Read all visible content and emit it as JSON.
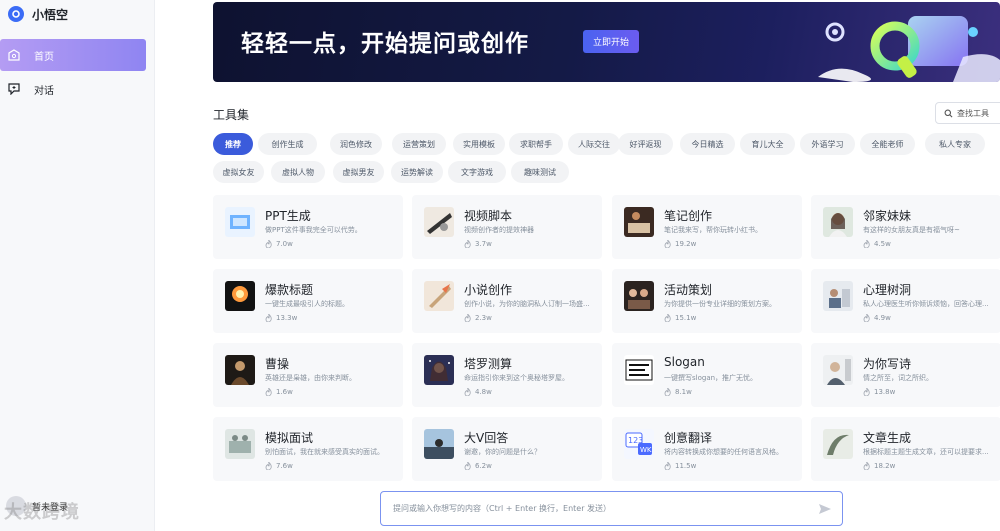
{
  "app": {
    "name": "小悟空"
  },
  "nav": [
    {
      "label": "首页",
      "icon": "home-icon",
      "active": true
    },
    {
      "label": "对话",
      "icon": "chat-icon",
      "active": false
    }
  ],
  "login": {
    "label": "暂未登录"
  },
  "watermark": "大数跨境",
  "banner": {
    "title": "轻轻一点，开始提问或创作",
    "button": "立即开始"
  },
  "tools": {
    "title": "工具集",
    "search_placeholder": "查找工具",
    "tags_row1": [
      "推荐",
      "创作生成",
      "润色修改",
      "运营策划",
      "实用模板",
      "求职帮手",
      "人际交往",
      "好评返现",
      "今日精选",
      "育儿大全",
      "外语学习",
      "全能老师",
      "私人专家"
    ],
    "tags_row2": [
      "虚拟女友",
      "虚拟人物",
      "虚拟男友",
      "运势解读",
      "文字游戏",
      "趣味测试"
    ],
    "active_tag": "推荐",
    "cards": [
      {
        "title": "PPT生成",
        "desc": "做PPT这件事我完全可以代劳。",
        "count": "7.0w",
        "thumb": "ppt"
      },
      {
        "title": "视频脚本",
        "desc": "视频创作者的提效神器",
        "count": "3.7w",
        "thumb": "video"
      },
      {
        "title": "笔记创作",
        "desc": "笔记我来写，帮你玩转小红书。",
        "count": "19.2w",
        "thumb": "notes"
      },
      {
        "title": "邻家妹妹",
        "desc": "有这样的女朋友真是有福气呀~",
        "count": "4.5w",
        "thumb": "girl"
      },
      {
        "title": "爆款标题",
        "desc": "一键生成最吸引人的标题。",
        "count": "13.3w",
        "thumb": "fire"
      },
      {
        "title": "小说创作",
        "desc": "创作小说，为你的脑洞私人订制一场盛...",
        "count": "2.3w",
        "thumb": "novel"
      },
      {
        "title": "活动策划",
        "desc": "为你提供一份专业详细的策划方案。",
        "count": "15.1w",
        "thumb": "event"
      },
      {
        "title": "心理树洞",
        "desc": "私人心理医生听你倾诉烦恼，回答心理...",
        "count": "4.9w",
        "thumb": "mind"
      },
      {
        "title": "曹操",
        "desc": "英雄还是枭雄，由你来判断。",
        "count": "1.6w",
        "thumb": "caocao"
      },
      {
        "title": "塔罗测算",
        "desc": "命运指引你来到这个奥秘塔罗屋。",
        "count": "4.8w",
        "thumb": "tarot"
      },
      {
        "title": "Slogan",
        "desc": "一键撰写slogan，推广无忧。",
        "count": "8.1w",
        "thumb": "slogan"
      },
      {
        "title": "为你写诗",
        "desc": "情之所至，词之所织。",
        "count": "13.8w",
        "thumb": "poem"
      },
      {
        "title": "模拟面试",
        "desc": "别怕面试，我在就来感受真实的面试。",
        "count": "7.6w",
        "thumb": "interview"
      },
      {
        "title": "大V回答",
        "desc": "谢邀，你的问题是什么？",
        "count": "6.2w",
        "thumb": "bigv"
      },
      {
        "title": "创意翻译",
        "desc": "将内容转换成你想要的任何语言风格。",
        "count": "11.5w",
        "thumb": "translate"
      },
      {
        "title": "文章生成",
        "desc": "根据标题主题生成文章，还可以提要求...",
        "count": "18.2w",
        "thumb": "article"
      }
    ]
  },
  "chat": {
    "placeholder": "提问或输入你想写的内容（Ctrl + Enter 换行，Enter 发送）"
  },
  "colors": {
    "accent": "#3b5bdb",
    "nav_active_start": "#b49cf3",
    "nav_active_end": "#8f85f2",
    "banner_bg": "#141a46"
  }
}
